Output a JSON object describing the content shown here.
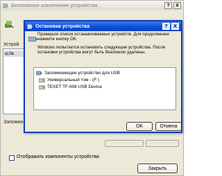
{
  "outer": {
    "title": "Безопасное извлечение устройства",
    "title_buttons": [
      "?",
      "X"
    ],
    "devices_label": "Устрой",
    "device_item": "Зв",
    "component_label": "Запомин",
    "show_components_label": "Отображать компоненты устройства",
    "close_button": "Закрыть"
  },
  "dialog": {
    "title": "Остановка устройства",
    "title_buttons": [
      "?",
      "X"
    ],
    "line1": "Проверьте список останавливаемых устройств. Для продолжения",
    "line2": "нажмите кнопку ОК.",
    "line3": "Windows попытается остановить следующие устройства. После",
    "line4": "остановки устройства могут быть безопасно удалены.",
    "items": [
      {
        "label": "Запоминающее устройство для USB",
        "icon": "usb-storage-icon"
      },
      {
        "label": "Универсальный том - (F:)",
        "icon": "drive-icon"
      },
      {
        "label": "TEXET TF-608 USB Device",
        "icon": "drive-icon"
      }
    ],
    "ok_button": "OK",
    "cancel_button": "Отмена"
  }
}
